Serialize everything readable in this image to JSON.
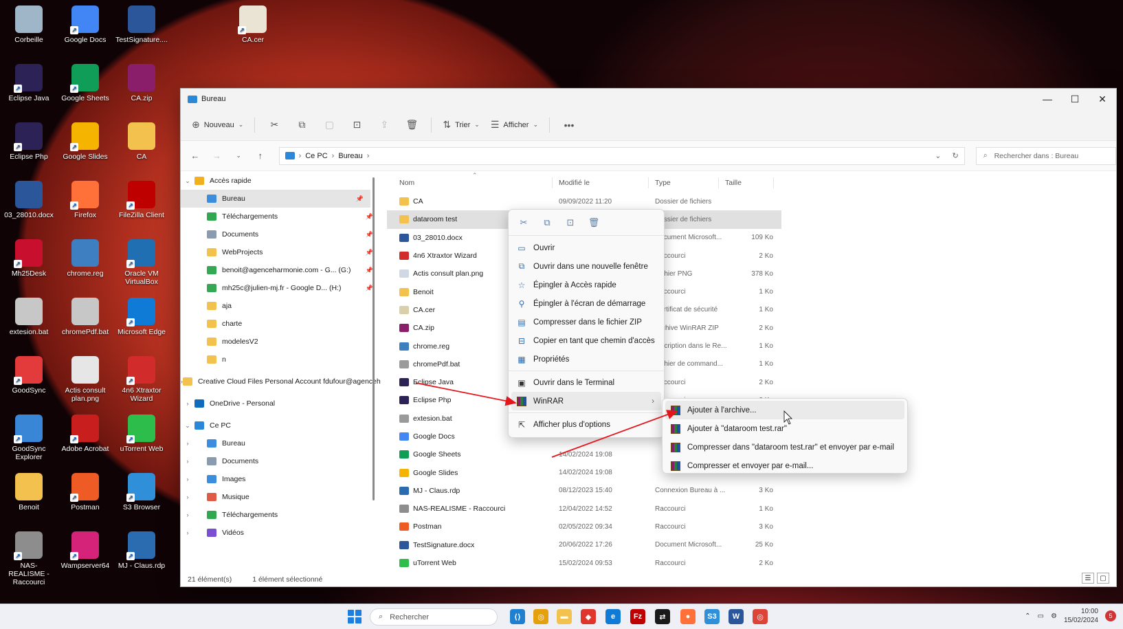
{
  "desktop": {
    "icons": [
      {
        "label": "Corbeille",
        "color": "#9fb6c8"
      },
      {
        "label": "Google Docs",
        "color": "#4285f4"
      },
      {
        "label": "TestSignature....",
        "color": "#2b579a"
      },
      {
        "label": "CA.cer",
        "color": "#e9e4d4"
      },
      {
        "label": "Eclipse Java",
        "color": "#2c2255"
      },
      {
        "label": "Google Sheets",
        "color": "#0f9d58"
      },
      {
        "label": "CA.zip",
        "color": "#8b1e6b"
      },
      {
        "label": "Eclipse Php",
        "color": "#2c2255"
      },
      {
        "label": "Google Slides",
        "color": "#f4b400"
      },
      {
        "label": "CA",
        "color": "#f2c14e"
      },
      {
        "label": "03_28010.docx",
        "color": "#2b579a"
      },
      {
        "label": "Firefox",
        "color": "#ff7139"
      },
      {
        "label": "FileZilla Client",
        "color": "#bf0000"
      },
      {
        "label": "Mh25Desk",
        "color": "#c8102e"
      },
      {
        "label": "chrome.reg",
        "color": "#3d7fc1"
      },
      {
        "label": "Oracle VM VirtualBox",
        "color": "#1f6fb2"
      },
      {
        "label": "extesion.bat",
        "color": "#c7c7c7"
      },
      {
        "label": "chromePdf.bat",
        "color": "#c7c7c7"
      },
      {
        "label": "Microsoft Edge",
        "color": "#0f7bd7"
      },
      {
        "label": "GoodSync",
        "color": "#e33b3b"
      },
      {
        "label": "Actis consult plan.png",
        "color": "#e6e6e6"
      },
      {
        "label": "4n6 Xtraxtor Wizard",
        "color": "#d12b2b"
      },
      {
        "label": "GoodSync Explorer",
        "color": "#3a86d6"
      },
      {
        "label": "Adobe Acrobat",
        "color": "#c91e1e"
      },
      {
        "label": "uTorrent Web",
        "color": "#2dbd4a"
      },
      {
        "label": "Benoit",
        "color": "#f2c14e"
      },
      {
        "label": "Postman",
        "color": "#ef5b25"
      },
      {
        "label": "S3 Browser",
        "color": "#2f8fd8"
      },
      {
        "label": "NAS-REALISME - Raccourci",
        "color": "#8d8d8d"
      },
      {
        "label": "Wampserver64",
        "color": "#d6237a"
      },
      {
        "label": "MJ - Claus.rdp",
        "color": "#2b6cb0"
      }
    ]
  },
  "window": {
    "title": "Bureau",
    "minimize": "—",
    "maximize": "☐",
    "close": "✕"
  },
  "toolbar": {
    "new_label": "Nouveau",
    "sort_label": "Trier",
    "view_label": "Afficher",
    "more_label": "•••"
  },
  "address": {
    "crumbs": [
      "Ce PC",
      "Bureau"
    ],
    "search_placeholder": "Rechercher dans : Bureau"
  },
  "navpane": {
    "items": [
      {
        "label": "Accès rapide",
        "chev": "⌄",
        "icon": "star",
        "indent": 0,
        "pin": false
      },
      {
        "label": "Bureau",
        "chev": "",
        "icon": "blue",
        "indent": 1,
        "pin": true,
        "selected": true
      },
      {
        "label": "Téléchargements",
        "chev": "",
        "icon": "green",
        "indent": 1,
        "pin": true
      },
      {
        "label": "Documents",
        "chev": "",
        "icon": "gray",
        "indent": 1,
        "pin": true
      },
      {
        "label": "WebProjects",
        "chev": "",
        "icon": "folder",
        "indent": 1,
        "pin": true
      },
      {
        "label": "benoit@agenceharmonie.com - G... (G:)",
        "chev": "",
        "icon": "drive",
        "indent": 1,
        "pin": true
      },
      {
        "label": "mh25c@julien-mj.fr - Google D... (H:)",
        "chev": "",
        "icon": "drive",
        "indent": 1,
        "pin": true
      },
      {
        "label": "aja",
        "chev": "",
        "icon": "folder",
        "indent": 1,
        "pin": false
      },
      {
        "label": "charte",
        "chev": "",
        "icon": "folder",
        "indent": 1,
        "pin": false
      },
      {
        "label": "modelesV2",
        "chev": "",
        "icon": "folder",
        "indent": 1,
        "pin": false
      },
      {
        "label": "n",
        "chev": "",
        "icon": "folder",
        "indent": 1,
        "pin": false
      },
      {
        "label": "Creative Cloud Files Personal Account fdufour@agenceh",
        "chev": "›",
        "icon": "folder",
        "indent": 0,
        "pin": false,
        "gap": true
      },
      {
        "label": "OneDrive - Personal",
        "chev": "›",
        "icon": "onedrive",
        "indent": 0,
        "pin": false,
        "gap": true
      },
      {
        "label": "Ce PC",
        "chev": "⌄",
        "icon": "pc",
        "indent": 0,
        "pin": false,
        "gap": true
      },
      {
        "label": "Bureau",
        "chev": "›",
        "icon": "blue",
        "indent": 1,
        "pin": false
      },
      {
        "label": "Documents",
        "chev": "›",
        "icon": "gray",
        "indent": 1,
        "pin": false
      },
      {
        "label": "Images",
        "chev": "›",
        "icon": "blue",
        "indent": 1,
        "pin": false
      },
      {
        "label": "Musique",
        "chev": "›",
        "icon": "music",
        "indent": 1,
        "pin": false
      },
      {
        "label": "Téléchargements",
        "chev": "›",
        "icon": "green",
        "indent": 1,
        "pin": false
      },
      {
        "label": "Vidéos",
        "chev": "›",
        "icon": "video",
        "indent": 1,
        "pin": false
      }
    ]
  },
  "filelist": {
    "headers": {
      "name": "Nom",
      "date": "Modifié le",
      "type": "Type",
      "size": "Taille"
    },
    "rows": [
      {
        "name": "CA",
        "date": "09/09/2022 11:20",
        "type": "Dossier de fichiers",
        "size": "",
        "icon": "#f2c14e"
      },
      {
        "name": "dataroom test",
        "date": "",
        "type": "Dossier de fichiers",
        "size": "",
        "icon": "#f2c14e",
        "selected": true
      },
      {
        "name": "03_28010.docx",
        "date": "",
        "type": "Document Microsoft...",
        "size": "109 Ko",
        "icon": "#2b579a"
      },
      {
        "name": "4n6 Xtraxtor Wizard",
        "date": "",
        "type": "Raccourci",
        "size": "2 Ko",
        "icon": "#d12b2b"
      },
      {
        "name": "Actis consult plan.png",
        "date": "",
        "type": "Fichier PNG",
        "size": "378 Ko",
        "icon": "#cfd8e3"
      },
      {
        "name": "Benoit",
        "date": "",
        "type": "Raccourci",
        "size": "1 Ko",
        "icon": "#f2c14e"
      },
      {
        "name": "CA.cer",
        "date": "",
        "type": "Certificat de sécurité",
        "size": "1 Ko",
        "icon": "#d9cfa8"
      },
      {
        "name": "CA.zip",
        "date": "",
        "type": "Archive WinRAR ZIP",
        "size": "2 Ko",
        "icon": "#8b1e6b"
      },
      {
        "name": "chrome.reg",
        "date": "",
        "type": "Inscription dans le Re...",
        "size": "1 Ko",
        "icon": "#3d7fc1"
      },
      {
        "name": "chromePdf.bat",
        "date": "",
        "type": "Fichier de command...",
        "size": "1 Ko",
        "icon": "#9a9a9a"
      },
      {
        "name": "Eclipse Java",
        "date": "",
        "type": "Raccourci",
        "size": "2 Ko",
        "icon": "#2c2255"
      },
      {
        "name": "Eclipse Php",
        "date": "",
        "type": "Raccourci",
        "size": "2 Ko",
        "icon": "#2c2255"
      },
      {
        "name": "extesion.bat",
        "date": "",
        "type": "",
        "size": "",
        "icon": "#9a9a9a"
      },
      {
        "name": "Google Docs",
        "date": "",
        "type": "",
        "size": "",
        "icon": "#4285f4"
      },
      {
        "name": "Google Sheets",
        "date": "14/02/2024 19:08",
        "type": "",
        "size": "",
        "icon": "#0f9d58"
      },
      {
        "name": "Google Slides",
        "date": "14/02/2024 19:08",
        "type": "",
        "size": "",
        "icon": "#f4b400"
      },
      {
        "name": "MJ - Claus.rdp",
        "date": "08/12/2023 15:40",
        "type": "Connexion Bureau à ...",
        "size": "3 Ko",
        "icon": "#2b6cb0"
      },
      {
        "name": "NAS-REALISME - Raccourci",
        "date": "12/04/2022 14:52",
        "type": "Raccourci",
        "size": "1 Ko",
        "icon": "#8d8d8d"
      },
      {
        "name": "Postman",
        "date": "02/05/2022 09:34",
        "type": "Raccourci",
        "size": "3 Ko",
        "icon": "#ef5b25"
      },
      {
        "name": "TestSignature.docx",
        "date": "20/06/2022 17:26",
        "type": "Document Microsoft...",
        "size": "25 Ko",
        "icon": "#2b579a"
      },
      {
        "name": "uTorrent Web",
        "date": "15/02/2024 09:53",
        "type": "Raccourci",
        "size": "2 Ko",
        "icon": "#2dbd4a"
      }
    ]
  },
  "status": {
    "count": "21 élément(s)",
    "selection": "1 élément sélectionné"
  },
  "context_menu": {
    "items": [
      {
        "label": "Ouvrir",
        "icon": "folder-open-icon",
        "glyph": "▭"
      },
      {
        "label": "Ouvrir dans une nouvelle fenêtre",
        "icon": "new-window-icon",
        "glyph": "⧉"
      },
      {
        "label": "Épingler à Accès rapide",
        "icon": "star-icon",
        "glyph": "☆"
      },
      {
        "label": "Épingler à l'écran de démarrage",
        "icon": "pin-icon",
        "glyph": "⚲"
      },
      {
        "label": "Compresser dans le fichier ZIP",
        "icon": "zip-icon",
        "glyph": "▤"
      },
      {
        "label": "Copier en tant que chemin d'accès",
        "icon": "path-icon",
        "glyph": "⊟"
      },
      {
        "label": "Propriétés",
        "icon": "properties-icon",
        "glyph": "▦"
      }
    ],
    "terminal": "Ouvrir dans le Terminal",
    "winrar": "WinRAR",
    "more": "Afficher plus d'options"
  },
  "submenu": {
    "items": [
      "Ajouter à l'archive...",
      "Ajouter à \"dataroom test.rar\"",
      "Compresser dans \"dataroom test.rar\" et envoyer par e-mail",
      "Compresser et envoyer par e-mail..."
    ]
  },
  "taskbar": {
    "search": "Rechercher",
    "time": "10:00",
    "date": "15/02/2024",
    "notifications": "5",
    "apps": [
      {
        "name": "vscode",
        "color": "#1f7fd0",
        "glyph": "⟨⟩"
      },
      {
        "name": "chrome",
        "color": "#e5a00d",
        "glyph": "◎"
      },
      {
        "name": "explorer",
        "color": "#f2c14e",
        "glyph": "▬"
      },
      {
        "name": "anydesk",
        "color": "#e0352b",
        "glyph": "◆"
      },
      {
        "name": "edge",
        "color": "#0f7bd7",
        "glyph": "e"
      },
      {
        "name": "filezilla",
        "color": "#bf0000",
        "glyph": "Fz"
      },
      {
        "name": "teamviewer",
        "color": "#1a1a1a",
        "glyph": "⇄"
      },
      {
        "name": "firefox",
        "color": "#ff7139",
        "glyph": "●"
      },
      {
        "name": "s3browser",
        "color": "#2f8fd8",
        "glyph": "S3"
      },
      {
        "name": "word",
        "color": "#2b579a",
        "glyph": "W"
      },
      {
        "name": "chrome-profile",
        "color": "#db4437",
        "glyph": "◎"
      }
    ]
  }
}
